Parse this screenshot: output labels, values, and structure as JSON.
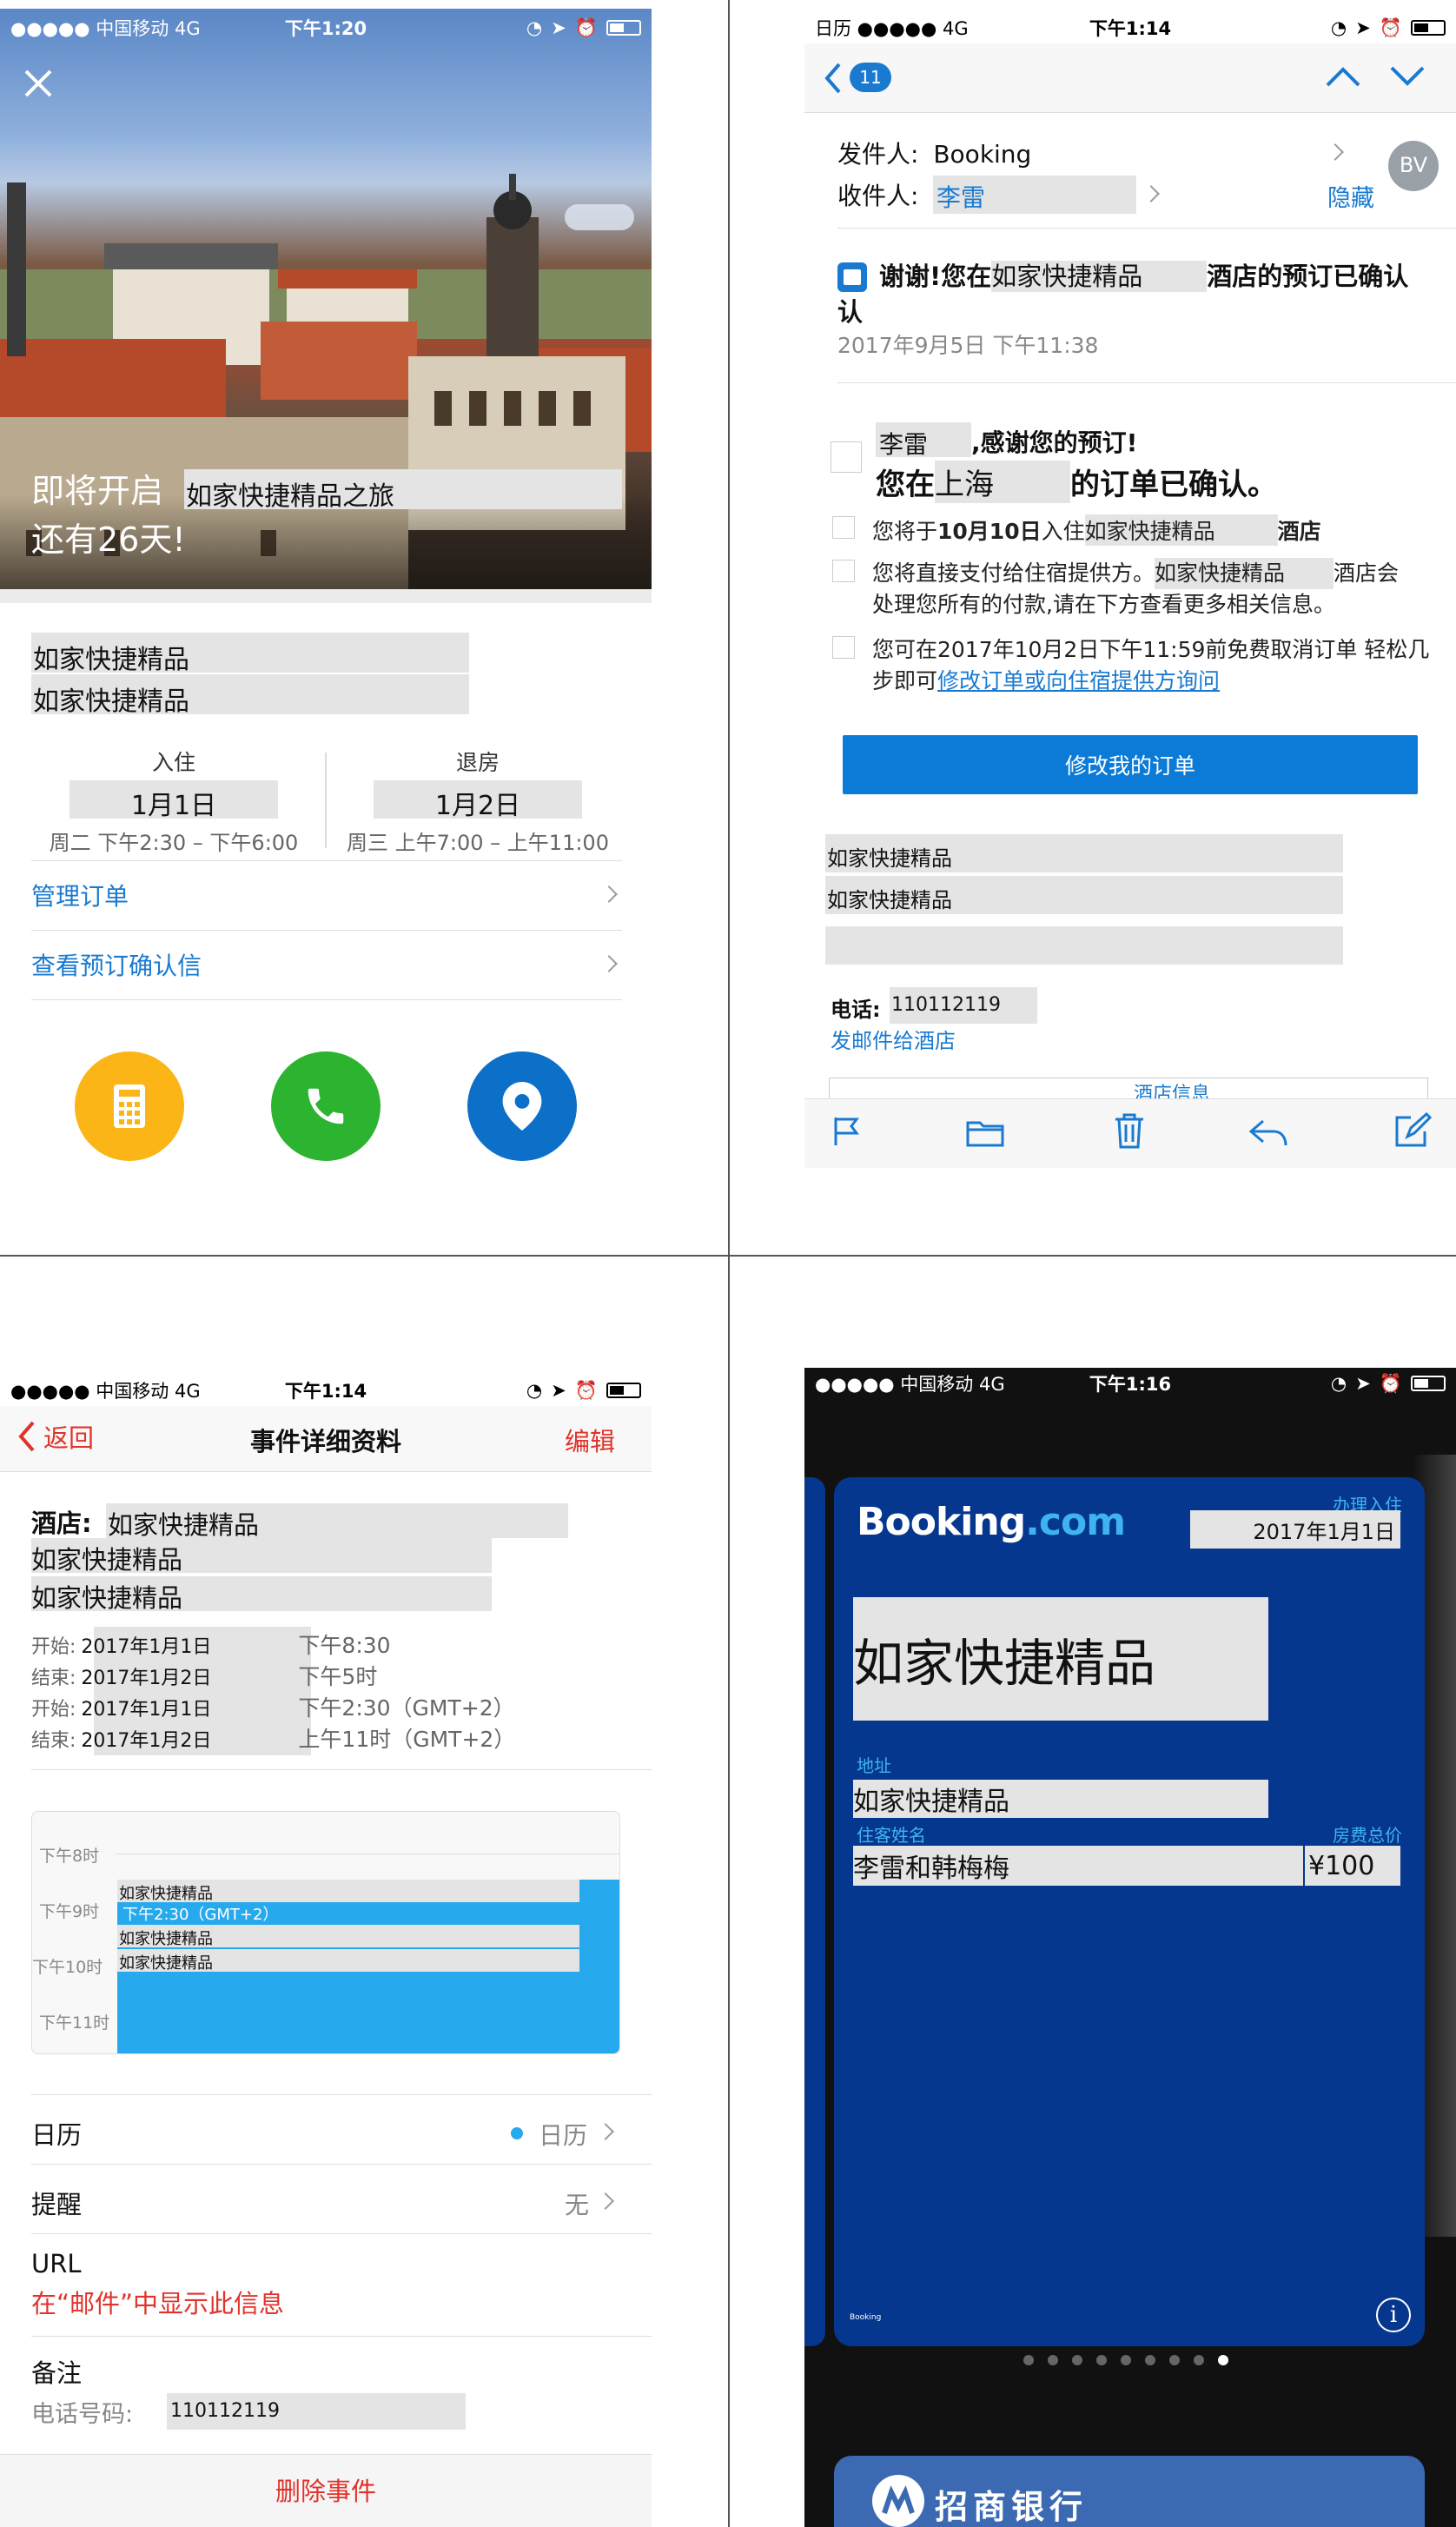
{
  "q1": {
    "status": {
      "carrier": "●●●●● 中国移动  4G",
      "time": "下午1:20"
    },
    "hero": {
      "prefix": "即将开启",
      "trip": "如家快捷精品之旅",
      "countdown": "还有26天!"
    },
    "hotel_name_1": "如家快捷精品",
    "hotel_name_2": "如家快捷精品",
    "checkin": {
      "label": "入住",
      "date": "1月1日",
      "time": "周二 下午2:30 – 下午6:00"
    },
    "checkout": {
      "label": "退房",
      "date": "1月2日",
      "time": "周三 上午7:00 – 上午11:00"
    },
    "links": [
      "管理订单",
      "查看预订确认信"
    ],
    "colors": {
      "yellow": "#fbb516",
      "green": "#2cb431",
      "blue": "#0c70c9"
    }
  },
  "q2": {
    "status": {
      "app": "日历 ●●●●●  4G",
      "time": "下午1:14"
    },
    "badge": "11",
    "sender_label": "发件人:",
    "sender": "Booking",
    "recipient_label": "收件人:",
    "recipient": "李雷",
    "hide": "隐藏",
    "avatar": "BV",
    "subject_a": "谢谢!您在",
    "subject_hotel": "如家快捷精品",
    "subject_b": "酒店的预订已确认",
    "date": "2017年9月5日 下午11:38",
    "greet_name": "李雷",
    "greet": ",感谢您的预订!",
    "confirm_a": "您在",
    "confirm_city": "上海",
    "confirm_b": "的订单已确认。",
    "line1_a": "您将于",
    "line1_date": "10月10日",
    "line1_b": "入住",
    "line1_hotel": "如家快捷精品",
    "line1_c": "酒店",
    "line2_a": "您将直接支付给住宿提供方。",
    "line2_hotel": "如家快捷精品",
    "line2_b": "酒店会",
    "line2_c": "处理您所有的付款,请在下方查看更多相关信息。",
    "line3_a": "您可在2017年10月2日下午11:59前免费取消订单 轻松几",
    "line3_b": "步即可",
    "line3_link": "修改订单或向住宿提供方询问",
    "modify_button": "修改我的订单",
    "info_hotel_1": "如家快捷精品",
    "info_hotel_2": "如家快捷精品",
    "phone_label": "电话:",
    "phone": "110112119",
    "email_hotel": "发邮件给酒店",
    "hotel_info": "酒店信息"
  },
  "q3": {
    "status": {
      "carrier": "●●●●● 中国移动  4G",
      "time": "下午1:14"
    },
    "back": "返回",
    "title": "事件详细资料",
    "edit": "编辑",
    "hotel_label": "酒店:",
    "hotel": "如家快捷精品",
    "hotel_2": "如家快捷精品",
    "hotel_3": "如家快捷精品",
    "times": [
      {
        "label": "开始:",
        "date": "2017年1月1日",
        "time": "下午8:30"
      },
      {
        "label": "结束:",
        "date": "2017年1月2日",
        "time": "下午5时"
      },
      {
        "label": "开始:",
        "date": "2017年1月1日",
        "time": "下午2:30（GMT+2）"
      },
      {
        "label": "结束:",
        "date": "2017年1月2日",
        "time": "上午11时（GMT+2）"
      }
    ],
    "hours": [
      "下午8时",
      "下午9时",
      "下午10时",
      "下午11时"
    ],
    "event_1": "如家快捷精品",
    "event_time": "下午2:30（GMT+2）",
    "event_2": "如家快捷精品",
    "event_3": "如家快捷精品",
    "calendar_label": "日历",
    "calendar_value": "日历",
    "alert_label": "提醒",
    "alert_value": "无",
    "url_label": "URL",
    "url_value": "在“邮件”中显示此信息",
    "notes_label": "备注",
    "notes_phone_label": "电话号码:",
    "notes_phone": "110112119",
    "delete": "删除事件"
  },
  "q4": {
    "status": {
      "carrier": "●●●●● 中国移动  4G",
      "time": "下午1:16"
    },
    "brand": "Booking",
    "brand_suffix": ".com",
    "checkin_label": "办理入住",
    "checkin_date": "2017年1月1日",
    "hotel": "如家快捷精品",
    "address_label": "地址",
    "address": "如家快捷精品",
    "guest_label": "住客姓名",
    "guest": "李雷和韩梅梅",
    "total_label": "房费总价",
    "total": "¥100",
    "small_brand": "Booking",
    "bank": "招商银行"
  }
}
